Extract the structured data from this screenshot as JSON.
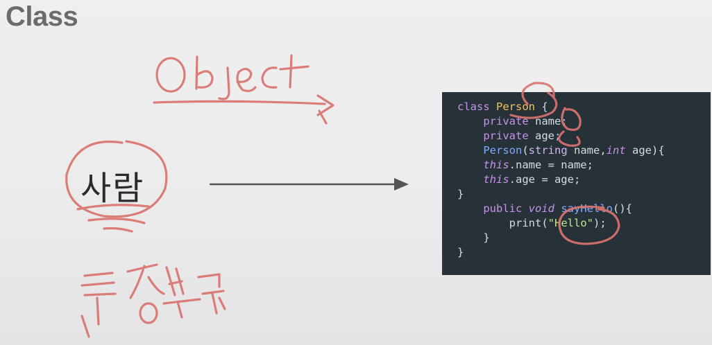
{
  "slide": {
    "title": "Class",
    "word": "사람"
  },
  "code": {
    "lines": [
      [
        {
          "t": "class ",
          "c": "kw"
        },
        {
          "t": "Person",
          "c": "cls"
        },
        {
          "t": " {",
          "c": "pl"
        }
      ],
      [
        {
          "t": "    private ",
          "c": "kw"
        },
        {
          "t": "name",
          "c": "pl"
        },
        {
          "t": ";",
          "c": "pn"
        }
      ],
      [
        {
          "t": "    private ",
          "c": "kw"
        },
        {
          "t": "age",
          "c": "pl"
        },
        {
          "t": ";",
          "c": "pn"
        }
      ],
      [
        {
          "t": "    Person",
          "c": "fn"
        },
        {
          "t": "(",
          "c": "pl"
        },
        {
          "t": "string",
          "c": "type"
        },
        {
          "t": " name,",
          "c": "pl"
        },
        {
          "t": "int",
          "c": "it"
        },
        {
          "t": " age){",
          "c": "pl"
        }
      ],
      [
        {
          "t": "    ",
          "c": "pl"
        },
        {
          "t": "this",
          "c": "it"
        },
        {
          "t": ".name = name;",
          "c": "pl"
        }
      ],
      [
        {
          "t": "    ",
          "c": "pl"
        },
        {
          "t": "this",
          "c": "it"
        },
        {
          "t": ".age = age;",
          "c": "pl"
        }
      ],
      [
        {
          "t": "}",
          "c": "pl"
        }
      ],
      [
        {
          "t": "    public ",
          "c": "kw"
        },
        {
          "t": "void",
          "c": "it"
        },
        {
          "t": " ",
          "c": "pl"
        },
        {
          "t": "sayHello",
          "c": "fn"
        },
        {
          "t": "(){",
          "c": "pl"
        }
      ],
      [
        {
          "t": "        print(",
          "c": "pl"
        },
        {
          "t": "\"Hello\"",
          "c": "str"
        },
        {
          "t": ");",
          "c": "pl"
        }
      ],
      [
        {
          "t": "    }",
          "c": "pl"
        }
      ],
      [
        {
          "t": "}",
          "c": "pl"
        }
      ]
    ]
  },
  "annotations": {
    "object_text": "Object",
    "handwriting_below": "특징분류",
    "ink_color": "#d9736f"
  },
  "colors": {
    "background": "#ececec",
    "title": "#6b6b6b",
    "code_background": "#263238",
    "arrow": "#555555"
  }
}
